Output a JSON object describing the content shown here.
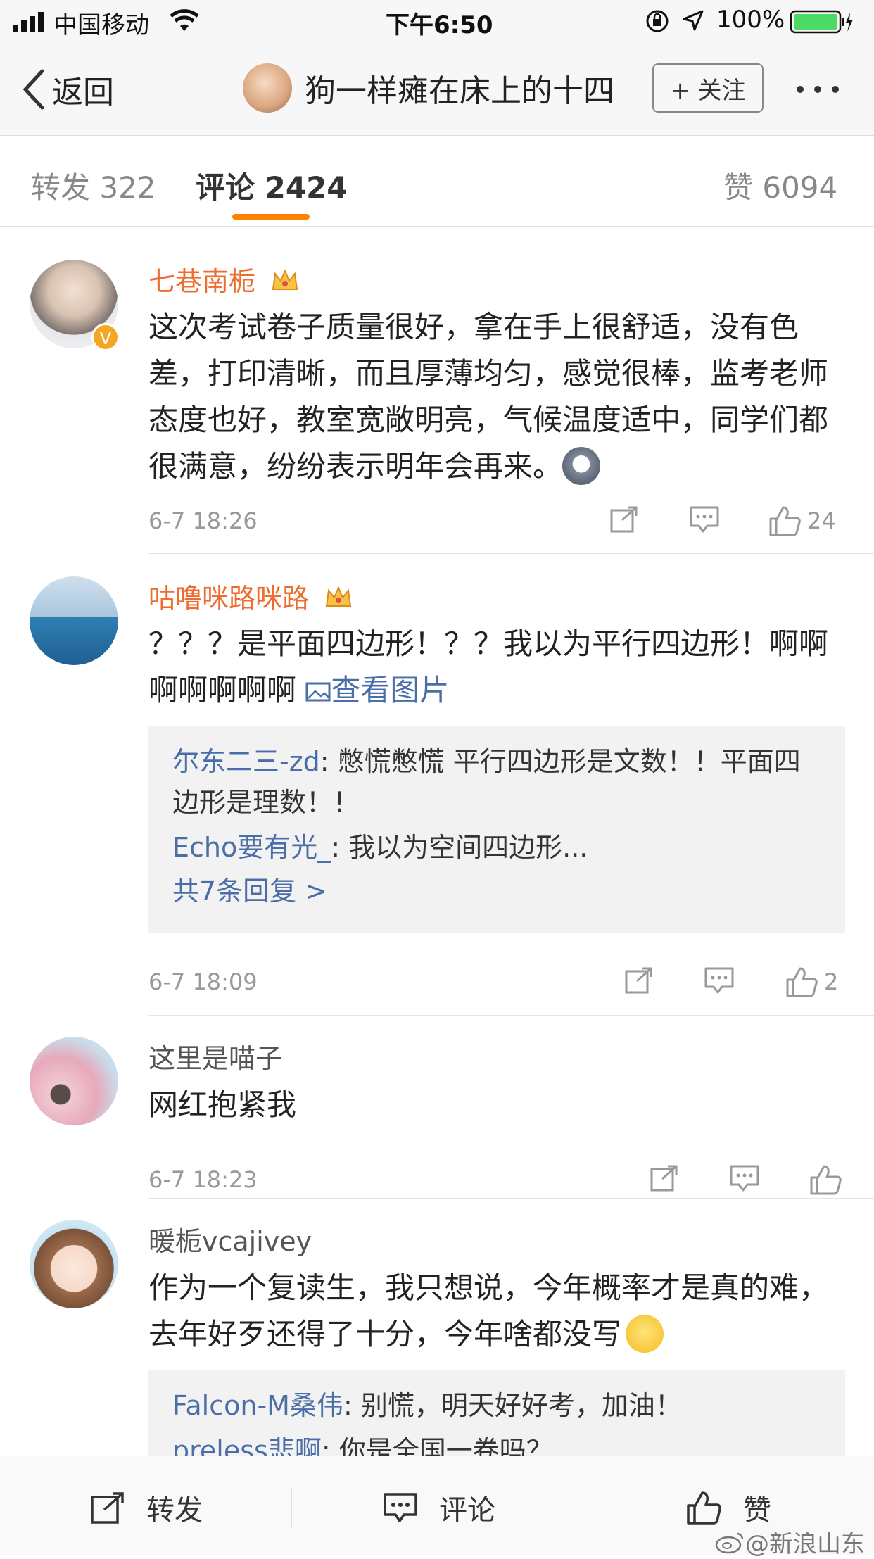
{
  "status_bar": {
    "carrier": "中国移动",
    "time": "下午6:50",
    "battery": "100%"
  },
  "nav": {
    "back_label": "返回",
    "title": "狗一样瘫在床上的十四",
    "follow_label": "+ 关注"
  },
  "tabs": {
    "repost": "转发 322",
    "comments": "评论 2424",
    "likes": "赞 6094"
  },
  "comments": [
    {
      "username": "七巷南栀",
      "text": "这次考试卷子质量很好，拿在手上很舒适，没有色差，打印清晰，而且厚薄均匀，感觉很棒，监考老师态度也好，教室宽敞明亮，气候温度适中，同学们都很满意，纷纷表示明年会再来。",
      "time": "6-7 18:26",
      "like_count": "24"
    },
    {
      "username": "咕噜咪路咪路",
      "text": "？？？是平面四边形！？？我以为平行四边形！啊啊啊啊啊啊啊",
      "view_image": "查看图片",
      "replies": [
        {
          "name": "尔东二三-zd",
          "text": ": 憋慌憋慌  平行四边形是文数！！平面四边形是理数！！"
        },
        {
          "name": "Echo要有光_",
          "text": ": 我以为空间四边形..."
        }
      ],
      "more_replies": "共7条回复 >",
      "time": "6-7 18:09",
      "like_count": "2"
    },
    {
      "username": "这里是喵子",
      "text": "网红抱紧我",
      "time": "6-7 18:23",
      "like_count": ""
    },
    {
      "username": "暖栀vcajivey",
      "text": "作为一个复读生，我只想说，今年概率才是真的难，去年好歹还得了十分，今年啥都没写",
      "replies": [
        {
          "name": "Falcon-M桑伟",
          "text": ": 别慌，明天好好考，加油！"
        },
        {
          "name": "preless悲啊",
          "text": ": 你是全国一卷吗？"
        }
      ]
    }
  ],
  "bottom_bar": {
    "repost": "转发",
    "comment": "评论",
    "like": "赞"
  },
  "watermark": "@新浪山东",
  "colors": {
    "accent": "#ff8200",
    "vip_name": "#ee6c2d",
    "link": "#4a6ea8"
  }
}
